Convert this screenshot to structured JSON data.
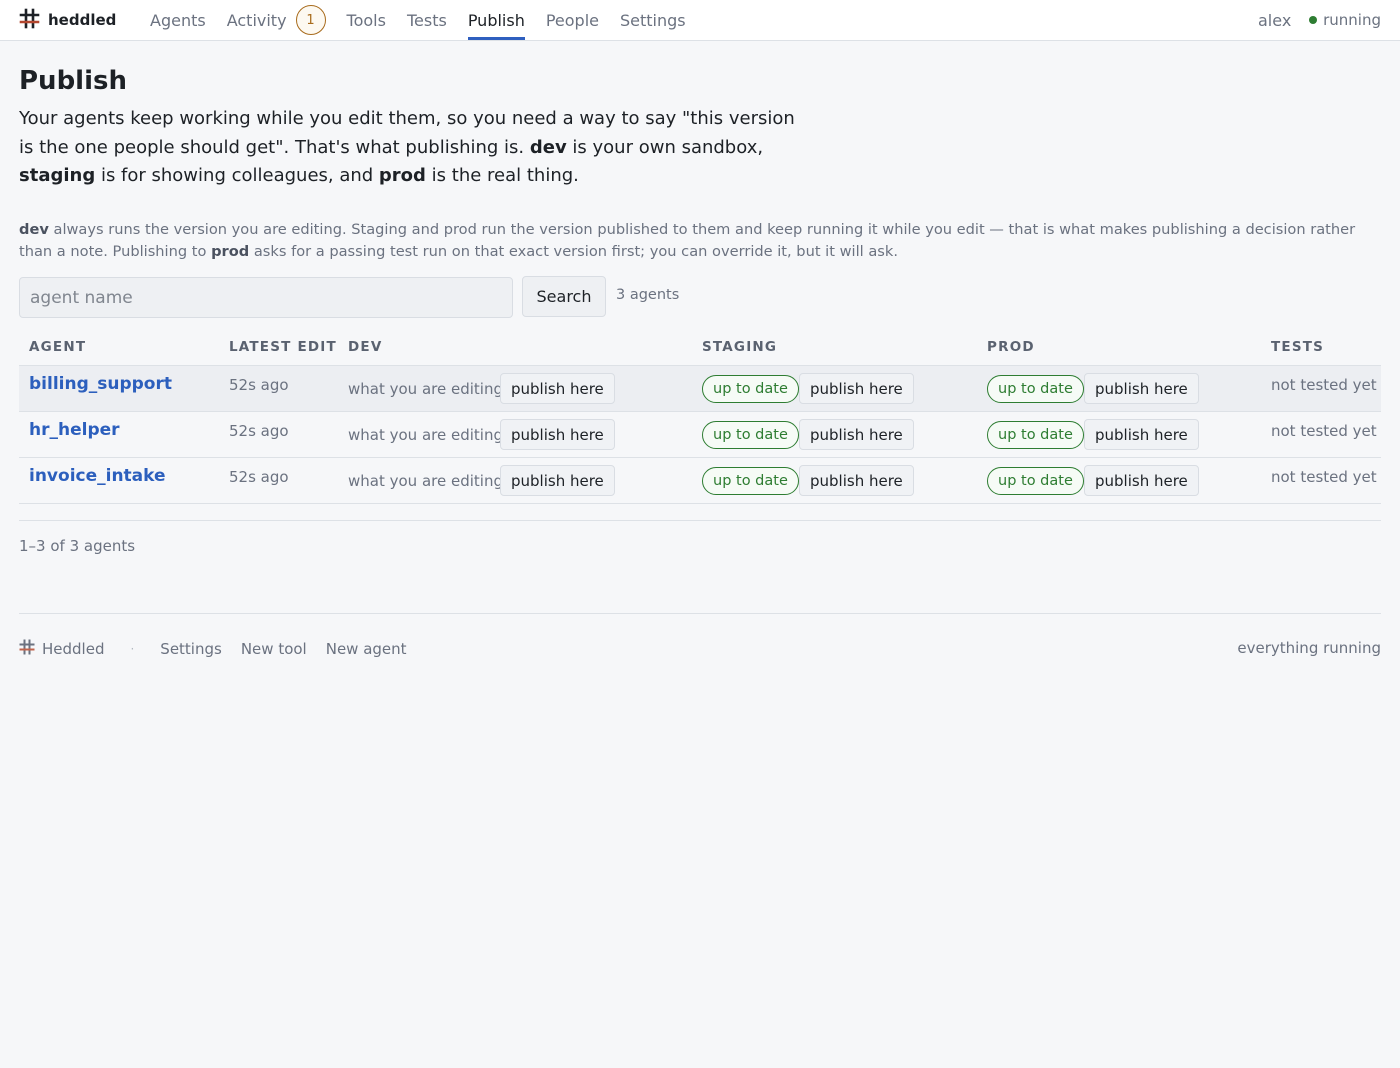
{
  "brand": {
    "name": "heddled",
    "icon": "hash-grid-logo-icon"
  },
  "nav": {
    "items": [
      {
        "label": "Agents"
      },
      {
        "label": "Activity",
        "badge": "1"
      },
      {
        "label": "Tools"
      },
      {
        "label": "Tests"
      },
      {
        "label": "Publish",
        "active": true
      },
      {
        "label": "People"
      },
      {
        "label": "Settings"
      }
    ],
    "user": "alex",
    "status": "running"
  },
  "page": {
    "title": "Publish",
    "lead": {
      "part1": "Your agents keep working while you edit them, so you need a way to say \"this version is the one people should get\". That's what publishing is. ",
      "dev": "dev",
      "part2": " is your own sandbox, ",
      "staging": "staging",
      "part3": " is for showing colleagues, and ",
      "prod": "prod",
      "part4": " is the real thing."
    },
    "note": {
      "dev": "dev",
      "part1": " always runs the version you are editing. Staging and prod run the version published to them and keep running it while you edit — that is what makes publishing a decision rather than a note. Publishing to ",
      "prod": "prod",
      "part2": " asks for a passing test run on that exact version first; you can override it, but it will ask."
    }
  },
  "search": {
    "placeholder": "agent name",
    "button_label": "Search",
    "count": "3 agents"
  },
  "table": {
    "headers": {
      "agent": "AGENT",
      "latest_edit": "LATEST EDIT",
      "dev": "DEV",
      "staging": "STAGING",
      "prod": "PROD",
      "tests": "TESTS"
    },
    "rows": [
      {
        "agent": "billing_support",
        "latest_edit": "52s ago",
        "dev_note": "what you are editing",
        "dev_button": "publish here",
        "staging_status": "up to date",
        "staging_button": "publish here",
        "prod_status": "up to date",
        "prod_button": "publish here",
        "tests": "not tested yet"
      },
      {
        "agent": "hr_helper",
        "latest_edit": "52s ago",
        "dev_note": "what you are editing",
        "dev_button": "publish here",
        "staging_status": "up to date",
        "staging_button": "publish here",
        "prod_status": "up to date",
        "prod_button": "publish here",
        "tests": "not tested yet"
      },
      {
        "agent": "invoice_intake",
        "latest_edit": "52s ago",
        "dev_note": "what you are editing",
        "dev_button": "publish here",
        "staging_status": "up to date",
        "staging_button": "publish here",
        "prod_status": "up to date",
        "prod_button": "publish here",
        "tests": "not tested yet"
      }
    ],
    "pager": "1–3 of 3 agents"
  },
  "footer": {
    "brand": "Heddled",
    "separator": "·",
    "links": [
      "Settings",
      "New tool",
      "New agent"
    ],
    "status": "everything running"
  },
  "colors": {
    "accent": "#2f5fbf",
    "link": "#2c5fbd",
    "ok_green": "#2e7d32",
    "badge_amber": "#a86b1c",
    "background": "#f6f7f9"
  }
}
